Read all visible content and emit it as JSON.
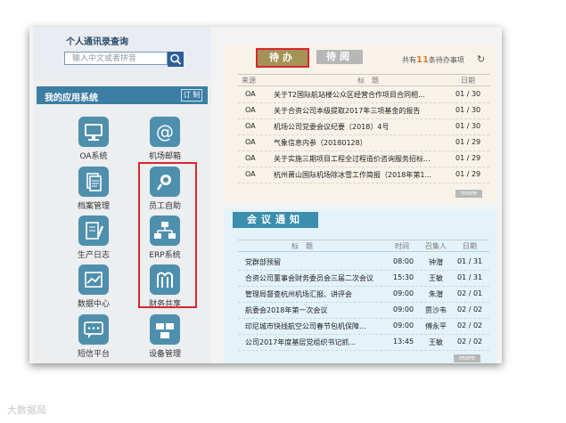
{
  "contacts": {
    "title": "个人通讯录查询",
    "search_placeholder": "输入中文或者拼音"
  },
  "apps": {
    "title": "我的应用系统",
    "customize_label": "订 制",
    "items": [
      {
        "label": "OA系统",
        "icon": "monitor-icon"
      },
      {
        "label": "机场邮箱",
        "icon": "at-sign-icon"
      },
      {
        "label": "档案管理",
        "icon": "documents-icon"
      },
      {
        "label": "员工自助",
        "icon": "employee-search-icon"
      },
      {
        "label": "生产日志",
        "icon": "log-pencil-icon"
      },
      {
        "label": "ERP系统",
        "icon": "org-chart-icon"
      },
      {
        "label": "数据中心",
        "icon": "data-center-icon"
      },
      {
        "label": "财务共享",
        "icon": "finance-share-icon"
      },
      {
        "label": "短信平台",
        "icon": "sms-icon"
      },
      {
        "label": "设备管理",
        "icon": "equipment-icon"
      }
    ]
  },
  "todo": {
    "tab_active": "待办",
    "tab_other": "待阅",
    "count_prefix": "共有",
    "count": "11",
    "count_suffix": "条待办事项",
    "headers": {
      "source": "来源",
      "title": "标　题",
      "date": "日期"
    },
    "rows": [
      {
        "source": "OA",
        "title": "关于T2国际航站楼公众区经营合作项目合同相...",
        "date": "01 / 30"
      },
      {
        "source": "OA",
        "title": "关于合资公司本级提取2017年三项基金的报告",
        "date": "01 / 30"
      },
      {
        "source": "OA",
        "title": "机场公司党委会议纪要（2018）4号",
        "date": "01 / 30"
      },
      {
        "source": "OA",
        "title": "气象信息内参（20180128）",
        "date": "01 / 29"
      },
      {
        "source": "OA",
        "title": "关于实施三期项目工程全过程造价咨询服务招标...",
        "date": "01 / 29"
      },
      {
        "source": "OA",
        "title": "杭州萧山国际机场除冰雪工作简报（2018年第1...",
        "date": "01 / 29"
      }
    ],
    "more_label": "more"
  },
  "meeting": {
    "title": "会议通知",
    "headers": {
      "title": "标　题",
      "time": "时间",
      "convener": "召集人",
      "date": "日期"
    },
    "rows": [
      {
        "title": "党群部预留",
        "time": "08:00",
        "convener": "钟潜",
        "date": "01 / 31"
      },
      {
        "title": "合资公司董事会财务委员会三届二次会议",
        "time": "15:30",
        "convener": "王敏",
        "date": "01 / 31"
      },
      {
        "title": "管理局督查杭州机场汇报、讲评会",
        "time": "09:00",
        "convener": "朱潜",
        "date": "02 / 01"
      },
      {
        "title": "航委会2018年第一次会议",
        "time": "09:00",
        "convener": "贾沙韦",
        "date": "02 / 02"
      },
      {
        "title": "印尼城市快线航空公司春节包机保障...",
        "time": "09:00",
        "convener": "傅永平",
        "date": "02 / 02"
      },
      {
        "title": "公司2017年度基层党组织书记抓...",
        "time": "13:45",
        "convener": "王敏",
        "date": "02 / 02"
      }
    ],
    "more_label": "more"
  },
  "watermark": "大数据局"
}
